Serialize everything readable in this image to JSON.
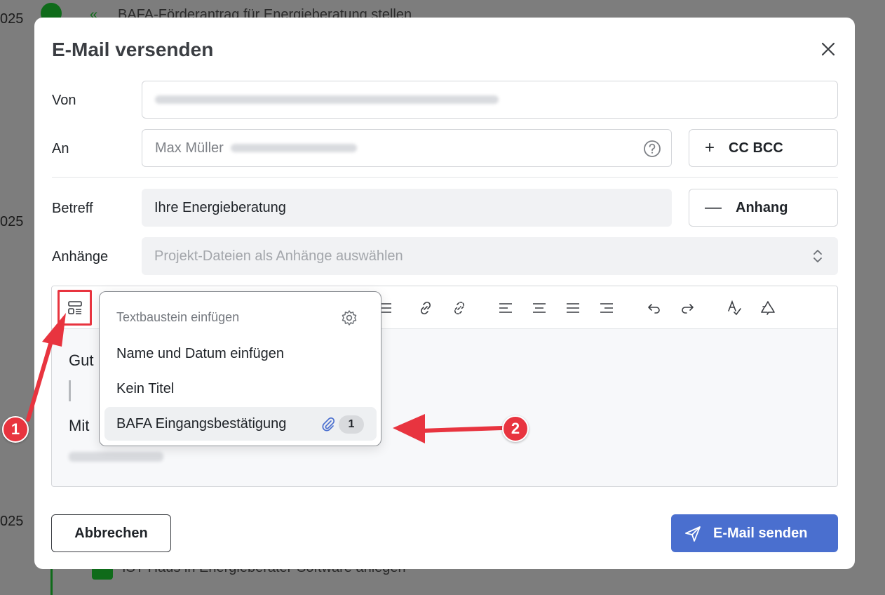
{
  "background": {
    "years": [
      "025",
      "025",
      "025"
    ],
    "task_top": "BAFA-Förderantrag für Energieberatung stellen",
    "task_bottom": "IST-Haus in Energieberater-Software anlegen"
  },
  "modal": {
    "title": "E-Mail versenden",
    "close_icon": "close-icon"
  },
  "form": {
    "from_label": "Von",
    "to_label": "An",
    "to_name": "Max Müller",
    "cc_bcc_label": "CC BCC",
    "subject_label": "Betreff",
    "subject_value": "Ihre Energieberatung",
    "attachment_toggle_label": "Anhang",
    "attachments_label": "Anhänge",
    "attachments_placeholder": "Projekt-Dateien als Anhänge auswählen"
  },
  "editor": {
    "line1": "Gut",
    "line3": "Mit"
  },
  "snippet_popup": {
    "header": "Textbaustein einfügen",
    "items": [
      {
        "label": "Name und Datum einfügen"
      },
      {
        "label": "Kein Titel"
      },
      {
        "label": "BAFA Eingangsbestätigung",
        "attachment_count": "1"
      }
    ]
  },
  "footer": {
    "cancel_label": "Abbrechen",
    "send_label": "E-Mail senden"
  },
  "annotations": {
    "marker_1": "1",
    "marker_2": "2"
  },
  "colors": {
    "accent": "#4a6fcf",
    "annotation": "#e8343f"
  }
}
